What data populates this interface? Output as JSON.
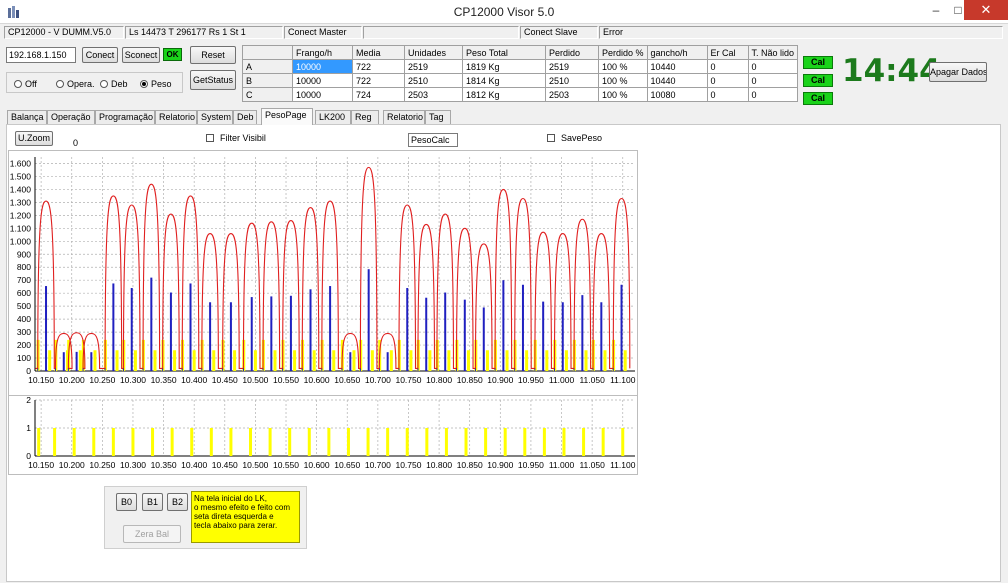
{
  "window": {
    "title": "CP12000 Visor 5.0",
    "minimize": "–",
    "maximize": "□",
    "close": "✕"
  },
  "status": {
    "version": "CP12000 - V DUMM.V5.0",
    "counters": "Ls 14473 T 296177 Rs 1 St 1",
    "master": "Conect Master",
    "slave": "Conect Slave",
    "error": "Error"
  },
  "conn": {
    "ip": "192.168.1.150",
    "connect": "Conect",
    "disconnect": "Sconect",
    "ok": "OK",
    "reset": "Reset",
    "getstatus": "GetStatus",
    "ok_color": "#1ad31a"
  },
  "modes": [
    {
      "label": "Off",
      "selected": false
    },
    {
      "label": "Opera.",
      "selected": false
    },
    {
      "label": "Deb",
      "selected": false
    },
    {
      "label": "Peso",
      "selected": true
    }
  ],
  "table": {
    "headers": [
      "Frango/h",
      "Media",
      "Unidades",
      "Peso Total",
      "Perdido",
      "Perdido %",
      "gancho/h",
      "Er Cal",
      "T. Não lido"
    ],
    "rows": [
      {
        "id": "A",
        "cells": [
          "10000",
          "722",
          "2519",
          "1819 Kg",
          "2519",
          "100 %",
          "10440",
          "0",
          "0"
        ]
      },
      {
        "id": "B",
        "cells": [
          "10000",
          "722",
          "2510",
          "1814 Kg",
          "2510",
          "100 %",
          "10440",
          "0",
          "0"
        ]
      },
      {
        "id": "C",
        "cells": [
          "10000",
          "724",
          "2503",
          "1812 Kg",
          "2503",
          "100 %",
          "10080",
          "0",
          "0"
        ]
      }
    ]
  },
  "cal": [
    "Cal",
    "Cal",
    "Cal"
  ],
  "cal_color": "#1ad31a",
  "clock": "14:44",
  "clear_button": "Apagar Dados",
  "tabs": [
    "Balança",
    "Operação",
    "Programação",
    "Relatorio",
    "System",
    "Deb",
    "PesoPage",
    "LK200",
    "Reg",
    "Relatorio",
    "Tag"
  ],
  "active_tab": "PesoPage",
  "pesopage": {
    "uzoom": "U.Zoom",
    "zoom_value": "0",
    "filter_label": "Filter Visibil",
    "filter_checked": false,
    "pesocalc": "PesoCalc",
    "savepeso_label": "SavePeso",
    "savepeso_checked": false
  },
  "chart_data": [
    {
      "type": "line",
      "title": "",
      "xlim": [
        10.14,
        11.12
      ],
      "ylim": [
        0,
        1650
      ],
      "yticks": [
        "0",
        "100",
        "200",
        "300",
        "400",
        "500",
        "600",
        "700",
        "800",
        "900",
        "1.000",
        "1.100",
        "1.200",
        "1.300",
        "1.400",
        "1.500",
        "1.600"
      ],
      "xticks": [
        "10.150",
        "10.200",
        "10.250",
        "10.300",
        "10.350",
        "10.400",
        "10.450",
        "10.500",
        "10.550",
        "10.600",
        "10.650",
        "10.700",
        "10.750",
        "10.800",
        "10.850",
        "10.900",
        "10.950",
        "11.000",
        "11.050",
        "11.100"
      ],
      "grid": true,
      "colors": {
        "envelope": "#e02020",
        "peak": "#2020c0",
        "marker": "#ffff00"
      },
      "series": [
        {
          "peaks": [
            [
              10.158,
              1310
            ],
            [
              10.187,
              290
            ],
            [
              10.208,
              295
            ],
            [
              10.232,
              290
            ],
            [
              10.268,
              1350
            ],
            [
              10.298,
              1280
            ],
            [
              10.33,
              1440
            ],
            [
              10.362,
              1210
            ],
            [
              10.394,
              1350
            ],
            [
              10.426,
              1060
            ],
            [
              10.46,
              1060
            ],
            [
              10.494,
              1140
            ],
            [
              10.526,
              1150
            ],
            [
              10.558,
              1160
            ],
            [
              10.59,
              1260
            ],
            [
              10.622,
              1310
            ],
            [
              10.655,
              290
            ],
            [
              10.685,
              1570
            ],
            [
              10.716,
              290
            ],
            [
              10.748,
              1280
            ],
            [
              10.779,
              1130
            ],
            [
              10.81,
              1210
            ],
            [
              10.842,
              1100
            ],
            [
              10.873,
              980
            ],
            [
              10.905,
              1400
            ],
            [
              10.937,
              1330
            ],
            [
              10.97,
              1070
            ],
            [
              11.002,
              1060
            ],
            [
              11.034,
              1170
            ],
            [
              11.065,
              1060
            ],
            [
              11.098,
              1330
            ]
          ]
        }
      ]
    },
    {
      "type": "bar",
      "title": "",
      "xlim": [
        10.14,
        11.12
      ],
      "ylim": [
        0,
        2
      ],
      "yticks": [
        "0",
        "1",
        "2"
      ],
      "xticks": [
        "10.150",
        "10.200",
        "10.250",
        "10.300",
        "10.350",
        "10.400",
        "10.450",
        "10.500",
        "10.550",
        "10.600",
        "10.650",
        "10.700",
        "10.750",
        "10.800",
        "10.850",
        "10.900",
        "10.950",
        "11.000",
        "11.050",
        "11.100"
      ],
      "grid": true,
      "color": "#ffff00",
      "x": [
        10.146,
        10.172,
        10.204,
        10.236,
        10.268,
        10.3,
        10.332,
        10.364,
        10.396,
        10.428,
        10.46,
        10.492,
        10.524,
        10.556,
        10.588,
        10.62,
        10.652,
        10.684,
        10.716,
        10.748,
        10.78,
        10.812,
        10.844,
        10.876,
        10.908,
        10.94,
        10.972,
        11.004,
        11.036,
        11.068,
        11.1
      ],
      "values": [
        1,
        1,
        1,
        1,
        1,
        1,
        1,
        1,
        1,
        1,
        1,
        1,
        1,
        1,
        1,
        1,
        1,
        1,
        1,
        1,
        1,
        1,
        1,
        1,
        1,
        1,
        1,
        1,
        1,
        1,
        1
      ]
    }
  ],
  "lk_panel": {
    "b0": "B0",
    "b1": "B1",
    "b2": "B2",
    "zera": "Zera Bal",
    "note_lines": [
      "Na tela inicial do LK,",
      "o mesmo efeito e feito com",
      "seta direta esquerda e",
      "tecla abaixo para zerar."
    ]
  }
}
